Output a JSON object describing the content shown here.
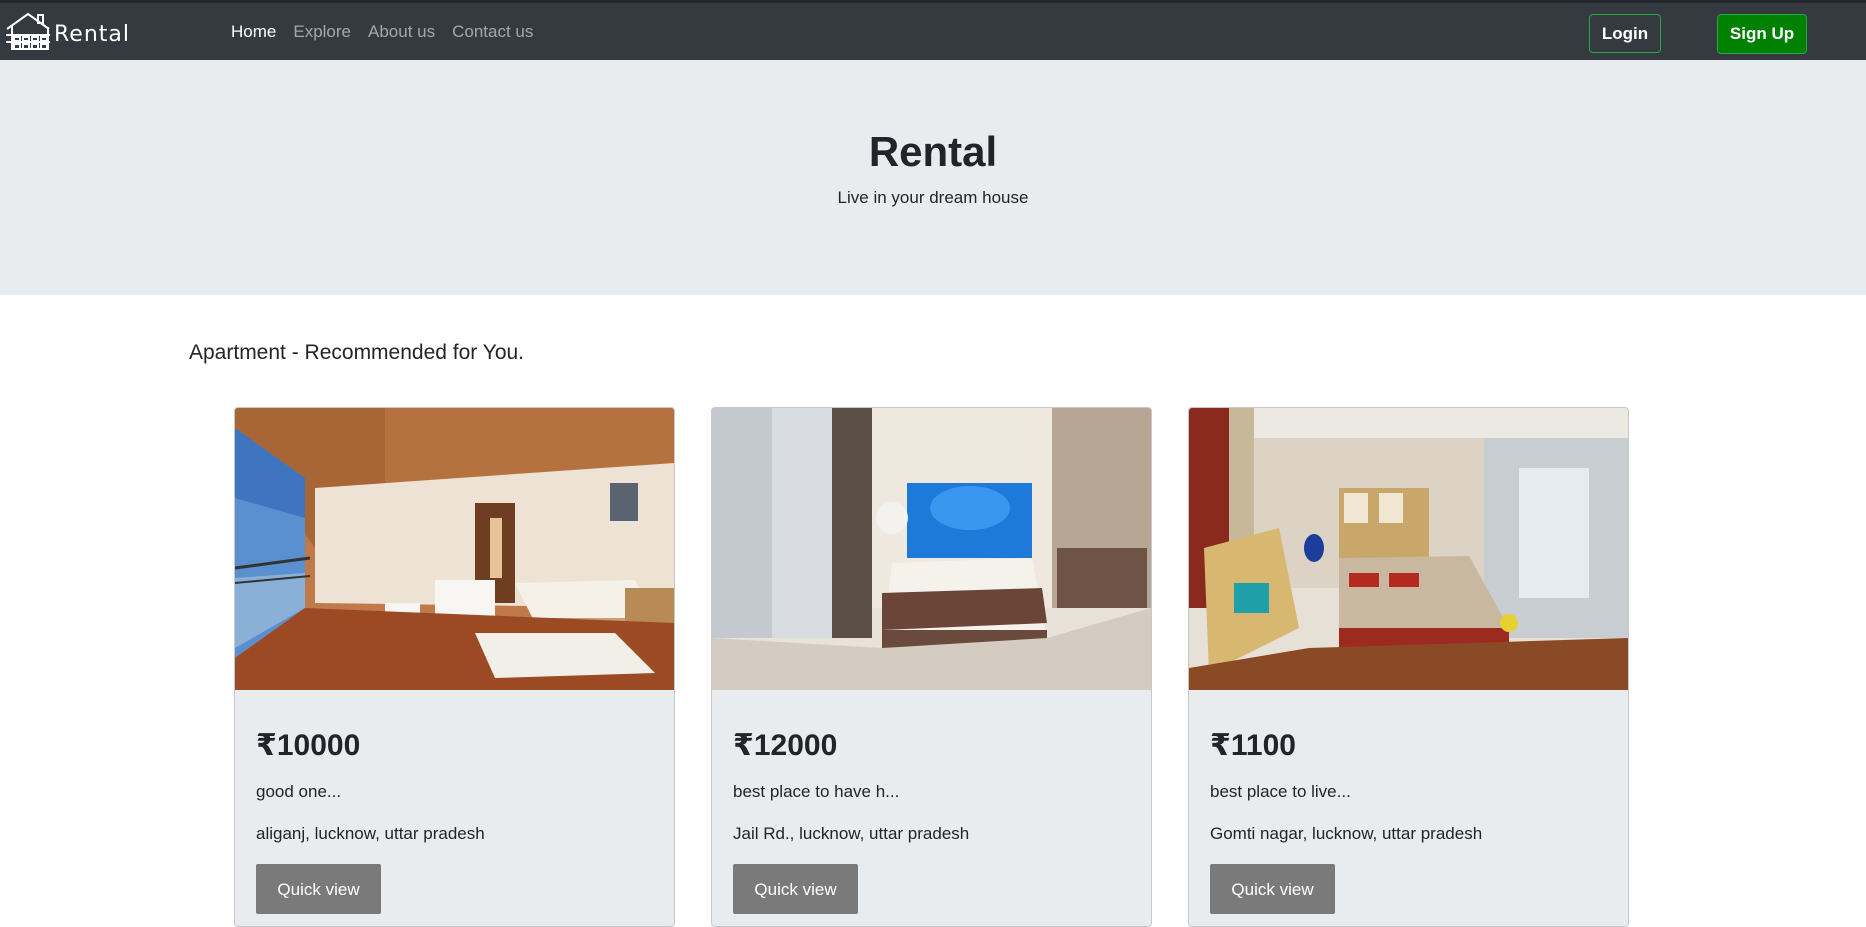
{
  "navbar": {
    "brand": "Rental",
    "brand_icon": "house-logo-icon",
    "links": [
      {
        "label": "Home",
        "active": true
      },
      {
        "label": "Explore",
        "active": false
      },
      {
        "label": "About us",
        "active": false
      },
      {
        "label": "Contact us",
        "active": false
      }
    ],
    "login_label": "Login",
    "signup_label": "Sign Up"
  },
  "hero": {
    "title": "Rental",
    "subtitle": "Live in your dream house"
  },
  "section": {
    "title": "Apartment - Recommended for You."
  },
  "cards": [
    {
      "price": "₹10000",
      "description": "good one...",
      "location": "aliganj, lucknow, uttar pradesh",
      "button": "Quick view",
      "image": "room-photo-balcony"
    },
    {
      "price": "₹12000",
      "description": "best place to have h...",
      "location": "Jail Rd., lucknow, uttar pradesh",
      "button": "Quick view",
      "image": "room-photo-blue-headboard"
    },
    {
      "price": "₹1100",
      "description": "best place to live...",
      "location": "Gomti nagar, lucknow, uttar pradesh",
      "button": "Quick view",
      "image": "room-photo-armchair"
    }
  ],
  "colors": {
    "navbar_bg": "#343a40",
    "hero_bg": "#e9ecef",
    "signup_bg": "#008000",
    "login_border": "#28a745",
    "quick_view_bg": "#7a7a7a"
  }
}
